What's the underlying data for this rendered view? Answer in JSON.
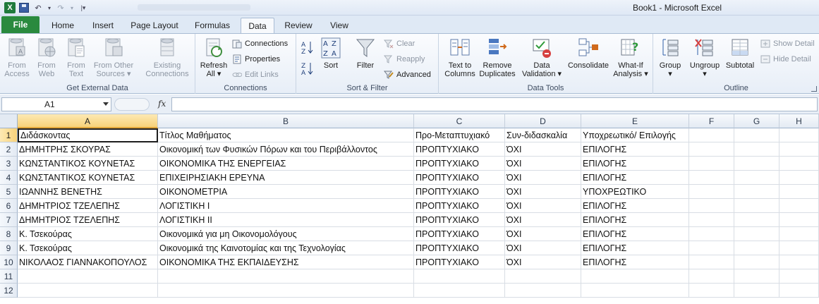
{
  "window": {
    "title": "Book1  -  Microsoft Excel"
  },
  "tabs": [
    {
      "label": "File"
    },
    {
      "label": "Home"
    },
    {
      "label": "Insert"
    },
    {
      "label": "Page Layout"
    },
    {
      "label": "Formulas"
    },
    {
      "label": "Data"
    },
    {
      "label": "Review"
    },
    {
      "label": "View"
    }
  ],
  "active_tab": "Data",
  "ribbon": {
    "get_external": {
      "label": "Get External Data",
      "from_access": "From\nAccess",
      "from_web": "From\nWeb",
      "from_text": "From\nText",
      "from_other": "From Other\nSources ▾",
      "existing": "Existing\nConnections"
    },
    "connections": {
      "label": "Connections",
      "refresh_all": "Refresh\nAll ▾",
      "connections": "Connections",
      "properties": "Properties",
      "edit_links": "Edit Links"
    },
    "sort_filter": {
      "label": "Sort & Filter",
      "sort": "Sort",
      "filter": "Filter",
      "clear": "Clear",
      "reapply": "Reapply",
      "advanced": "Advanced"
    },
    "data_tools": {
      "label": "Data Tools",
      "text_to_columns": "Text to\nColumns",
      "remove_duplicates": "Remove\nDuplicates",
      "data_validation": "Data\nValidation ▾",
      "consolidate": "Consolidate",
      "what_if": "What-If\nAnalysis ▾"
    },
    "outline": {
      "label": "Outline",
      "group": "Group\n▾",
      "ungroup": "Ungroup\n▾",
      "subtotal": "Subtotal",
      "show_detail": "Show Detail",
      "hide_detail": "Hide Detail"
    }
  },
  "formula_bar": {
    "name_box": "A1",
    "fx": "fx",
    "content": ""
  },
  "sheet": {
    "columns": [
      "A",
      "B",
      "C",
      "D",
      "E",
      "F",
      "G",
      "H"
    ],
    "row_numbers": [
      "1",
      "2",
      "3",
      "4",
      "5",
      "6",
      "7",
      "8",
      "9",
      "10",
      "11",
      "12"
    ],
    "rows": [
      [
        "Διδάσκοντας",
        "Τίτλος Μαθήματος",
        "Προ-Μεταπτυχιακό",
        "Συν-διδασκαλία",
        "Υποχρεωτικό/ Επιλογής"
      ],
      [
        "ΔΗΜΗΤΡΗΣ ΣΚΟΥΡΑΣ",
        "Οικονομική των Φυσικών Πόρων και του Περιβάλλοντος",
        "ΠΡΟΠΤΥΧΙΑΚΟ",
        "ΌΧΙ",
        "ΕΠΙΛΟΓΗΣ"
      ],
      [
        "ΚΩΝΣΤΑΝΤΙΚΟΣ ΚΟΥΝΕΤΑΣ",
        "ΟΙΚΟΝΟΜΙΚΑ ΤΗΣ ΕΝΕΡΓΕΙΑΣ",
        "ΠΡΟΠΤΥΧΙΑΚΟ",
        "ΌΧΙ",
        "ΕΠΙΛΟΓΗΣ"
      ],
      [
        "ΚΩΝΣΤΑΝΤΙΚΟΣ ΚΟΥΝΕΤΑΣ",
        "ΕΠΙΧΕΙΡΗΣΙΑΚΗ ΕΡΕΥΝΑ",
        "ΠΡΟΠΤΥΧΙΑΚΟ",
        "ΌΧΙ",
        "ΕΠΙΛΟΓΗΣ"
      ],
      [
        "ΙΩΑΝΝΗΣ ΒΕΝΕΤΗΣ",
        "ΟΙΚΟΝΟΜΕΤΡΙΑ",
        "ΠΡΟΠΤΥΧΙΑΚΟ",
        "ΌΧΙ",
        "ΥΠΟΧΡΕΩΤΙΚΟ"
      ],
      [
        "ΔΗΜΗΤΡΙΟΣ ΤΖΕΛΕΠΗΣ",
        "ΛΟΓΙΣΤΙΚΗ Ι",
        "ΠΡΟΠΤΥΧΙΑΚΟ",
        "ΌΧΙ",
        "ΕΠΙΛΟΓΗΣ"
      ],
      [
        "ΔΗΜΗΤΡΙΟΣ ΤΖΕΛΕΠΗΣ",
        "ΛΟΓΙΣΤΙΚΗ ΙΙ",
        "ΠΡΟΠΤΥΧΙΑΚΟ",
        "ΌΧΙ",
        "ΕΠΙΛΟΓΗΣ"
      ],
      [
        "Κ. Τσεκούρας",
        "Οικονομικά για μη Οικονομολόγους",
        "ΠΡΟΠΤΥΧΙΑΚΟ",
        "ΌΧΙ",
        "ΕΠΙΛΟΓΗΣ"
      ],
      [
        "Κ. Τσεκούρας",
        "Οικονομικά της Καινοτομίας και της Τεχνολογίας",
        "ΠΡΟΠΤΥΧΙΑΚΟ",
        "ΌΧΙ",
        "ΕΠΙΛΟΓΗΣ"
      ],
      [
        "ΝΙΚΟΛΑΟΣ ΓΙΑΝΝΑΚΟΠΟΥΛΟΣ",
        "ΟΙΚΟΝΟΜΙΚΑ ΤΗΣ ΕΚΠΑΙΔΕΥΣΗΣ",
        "ΠΡΟΠΤΥΧΙΑΚΟ",
        "ΌΧΙ",
        "ΕΠΙΛΟΓΗΣ"
      ],
      [
        "",
        "",
        "",
        "",
        ""
      ],
      [
        "",
        "",
        "",
        "",
        ""
      ]
    ]
  }
}
